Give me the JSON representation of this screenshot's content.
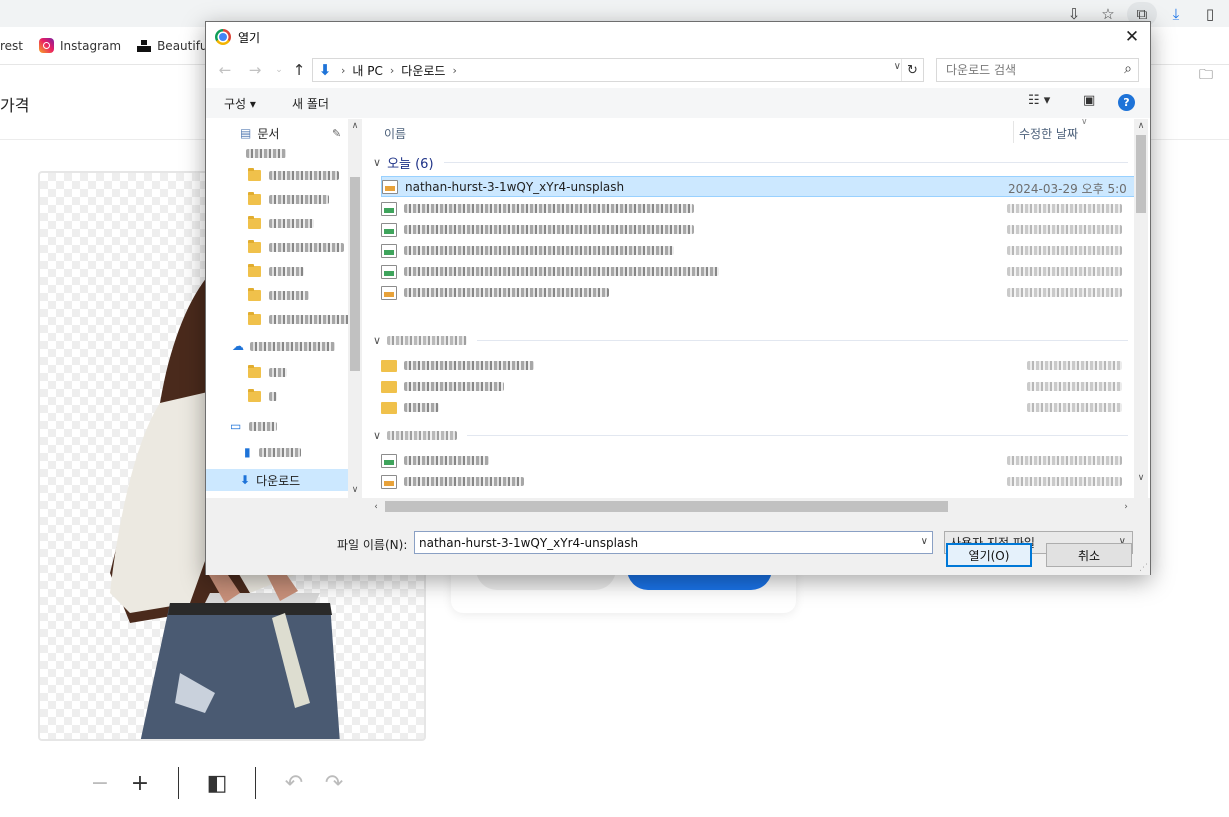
{
  "browser": {
    "bookmarks": [
      {
        "label": "rest"
      },
      {
        "label": "Instagram"
      },
      {
        "label": "Beautiful F"
      }
    ]
  },
  "site": {
    "nav_text": "가격"
  },
  "dialog": {
    "title": "열기",
    "breadcrumb": [
      "내 PC",
      "다운로드"
    ],
    "search_placeholder": "다운로드 검색",
    "commands": {
      "organize": "구성 ▾",
      "new_folder": "새 폴더"
    },
    "nav_pane": {
      "items": [
        {
          "label": "문서"
        },
        {
          "label": "다운로드"
        }
      ]
    },
    "columns": {
      "name": "이름",
      "date": "수정한 날짜"
    },
    "groups": [
      {
        "label": "오늘 (6)"
      }
    ],
    "selected_file": {
      "name": "nathan-hurst-3-1wQY_xYr4-unsplash",
      "date": "2024-03-29 오후 5:0"
    },
    "filename_label": "파일 이름(N):",
    "filename_value": "nathan-hurst-3-1wQY_xYr4-unsplash",
    "filetype": "사용자 지정 파일",
    "open_button": "열기(O)",
    "cancel_button": "취소"
  },
  "colors": {
    "accent": "#1a73e8",
    "selection": "#cce8ff",
    "dialog_footer": "#f0f0f0"
  },
  "icons": [
    "chrome-icon",
    "close-icon",
    "back-icon",
    "forward-icon",
    "up-icon",
    "download-arrow-icon",
    "refresh-icon",
    "search-icon",
    "view-options-icon",
    "preview-pane-icon",
    "help-icon",
    "folder-icon",
    "image-file-icon",
    "zoom-out-icon",
    "zoom-in-icon",
    "compare-icon",
    "undo-icon",
    "redo-icon"
  ]
}
